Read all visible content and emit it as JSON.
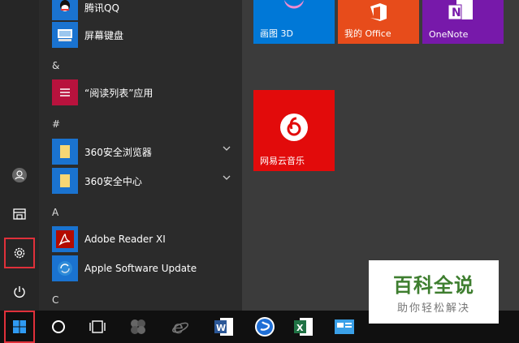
{
  "app_list": {
    "items": [
      {
        "label": "腾讯QQ",
        "icon": "qq-icon"
      },
      {
        "label": "屏幕键盘",
        "icon": "onscreen-keyboard-icon"
      },
      {
        "label": "“阅读列表”应用",
        "icon": "reading-list-icon"
      },
      {
        "label": "360安全浏览器",
        "icon": "folder-icon",
        "expandable": true
      },
      {
        "label": "360安全中心",
        "icon": "folder-icon",
        "expandable": true
      },
      {
        "label": "Adobe Reader XI",
        "icon": "adobe-reader-icon"
      },
      {
        "label": "Apple Software Update",
        "icon": "apple-update-icon"
      }
    ],
    "headers": {
      "amp": "&",
      "hash": "#",
      "a": "A",
      "c": "C"
    }
  },
  "tiles": [
    {
      "label": "画图 3D",
      "color": "#0078d7",
      "icon": "paint3d-icon"
    },
    {
      "label": "我的 Office",
      "color": "#e74c1b",
      "icon": "office-icon"
    },
    {
      "label": "OneNote",
      "color": "#7719aa",
      "icon": "onenote-icon"
    },
    {
      "label": "网易云音乐",
      "color": "#e20b0b",
      "icon": "netease-music-icon"
    }
  ],
  "sidebar": {
    "user": "user-icon",
    "documents": "documents-icon",
    "settings": "settings-icon",
    "power": "power-icon",
    "start": "windows-start-icon"
  },
  "watermark": {
    "title": "百科全说",
    "subtitle": "助你轻松解决"
  },
  "colors": {
    "highlight": "#e0303a",
    "accent": "#0078d7"
  }
}
